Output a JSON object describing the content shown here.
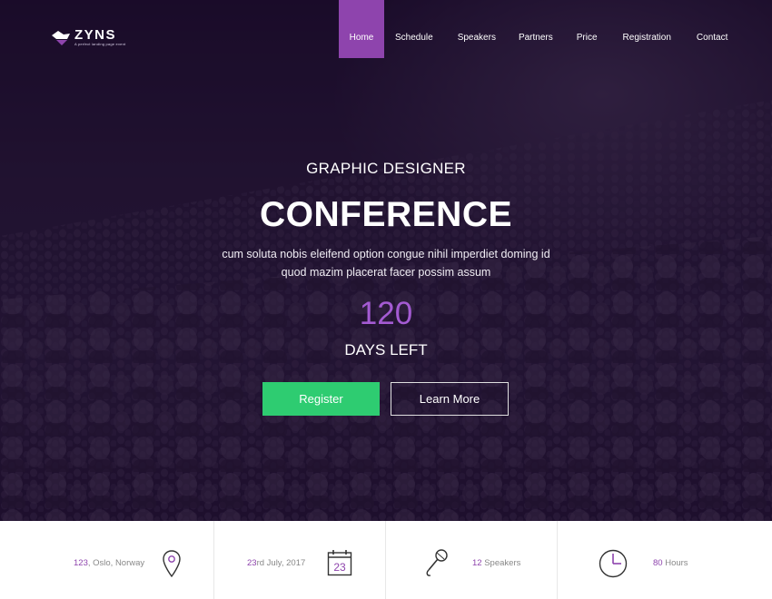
{
  "brand": {
    "name": "ZYNS",
    "tagline": "A perfect landing page event"
  },
  "nav": {
    "items": [
      "Home",
      "Schedule",
      "Speakers",
      "Partners",
      "Price",
      "Registration",
      "Contact"
    ],
    "active": "Home"
  },
  "hero": {
    "kicker": "GRAPHIC DESIGNER",
    "headline": "CONFERENCE",
    "lead_line1": "cum soluta nobis eleifend option congue nihil imperdiet doming id",
    "lead_line2": "quod mazim placerat facer possim assum",
    "countdown_value": "120",
    "countdown_label": "DAYS LEFT",
    "register_label": "Register",
    "learn_more_label": "Learn More"
  },
  "info": {
    "location_number": "123",
    "location_rest": ", Oslo, Norway",
    "date_day": "23",
    "date_rest": "rd July, 2017",
    "calendar_day": "23",
    "speakers_count": "12",
    "speakers_label": " Speakers",
    "hours_count": "80",
    "hours_label": " Hours"
  },
  "colors": {
    "accent": "#8e44ad",
    "count_purple": "#a45bd3",
    "register_green": "#2ecc71",
    "hero_overlay": "#1a0a28"
  },
  "icons": [
    "logo-mark",
    "map-pin-icon",
    "calendar-icon",
    "microphone-icon",
    "clock-icon"
  ]
}
